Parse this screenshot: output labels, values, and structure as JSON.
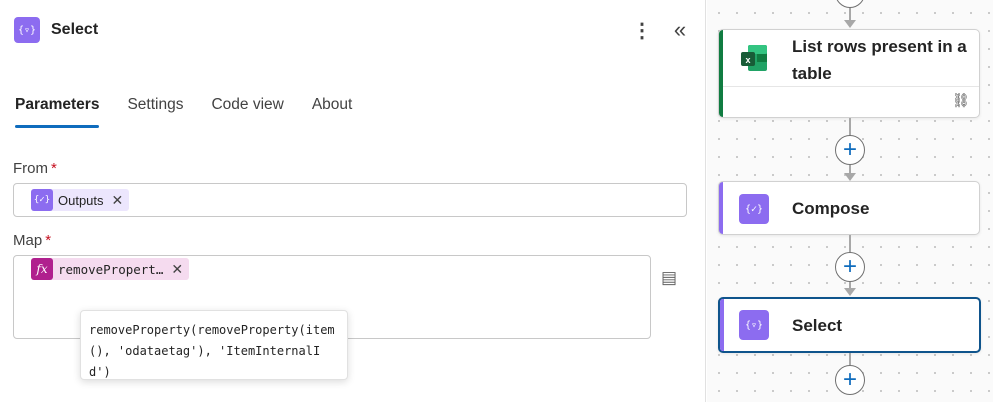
{
  "panel": {
    "title": "Select",
    "header_icon_glyph": "{▿}",
    "more_glyph": "⋮",
    "collapse_glyph": "«",
    "tabs": [
      {
        "label": "Parameters",
        "active": true
      },
      {
        "label": "Settings",
        "active": false
      },
      {
        "label": "Code view",
        "active": false
      },
      {
        "label": "About",
        "active": false
      }
    ],
    "from": {
      "label": "From",
      "required_mark": "*",
      "token_icon_glyph": "{✓}",
      "token_label": "Outputs",
      "remove_glyph": "✕"
    },
    "map": {
      "label": "Map",
      "required_mark": "*",
      "token_icon_glyph": "fx",
      "token_label": "removePropert…",
      "remove_glyph": "✕",
      "switch_icon_glyph": "▤"
    },
    "tooltip_text": "removeProperty(removeProperty(item(), 'odataetag'), 'ItemInternalId')"
  },
  "canvas": {
    "plus_glyph": "+",
    "cards": [
      {
        "title": "List rows present in a table",
        "accent": "#107c41",
        "icon": "excel-icon",
        "link_glyph": "⛓"
      },
      {
        "title": "Compose",
        "accent": "#8c6cf0",
        "icon_glyph": "{✓}"
      },
      {
        "title": "Select",
        "accent": "#8c6cf0",
        "icon_glyph": "{▿}",
        "selected": true
      }
    ]
  },
  "colors": {
    "accent_blue": "#0f6cbd",
    "action_purple": "#8c6cf0",
    "fx_magenta": "#b0208e",
    "excel_green": "#107c41",
    "required_red": "#c50f1f"
  }
}
